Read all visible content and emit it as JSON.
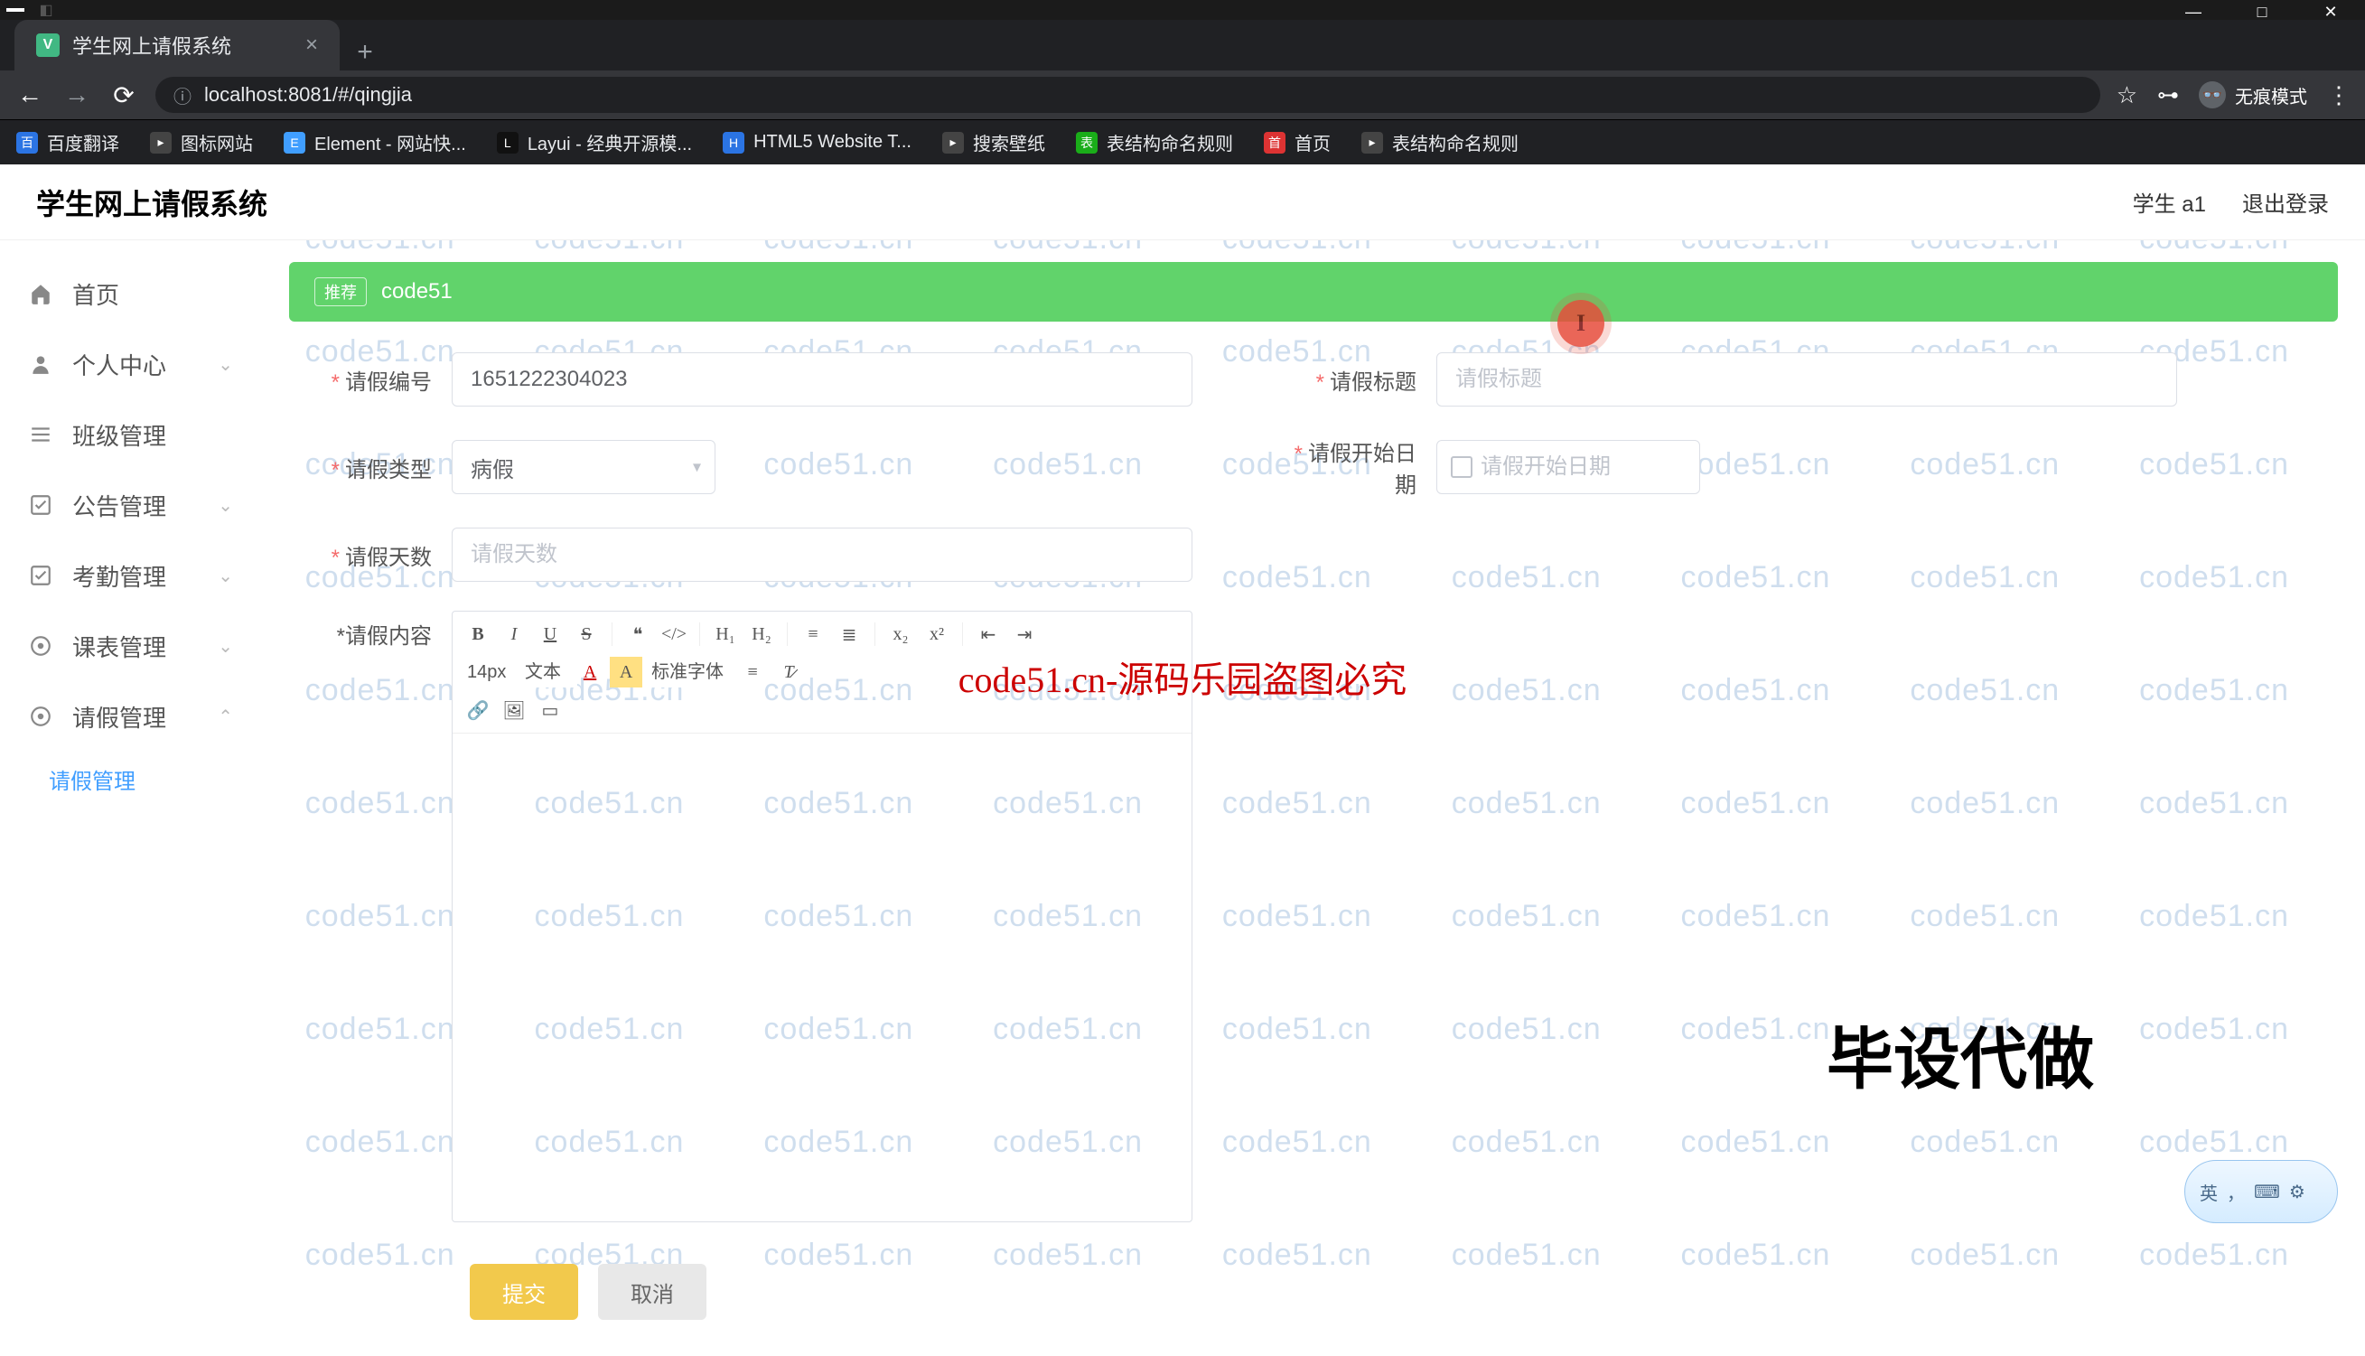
{
  "browser": {
    "tab_title": "学生网上请假系统",
    "url": "localhost:8081/#/qingjia",
    "incognito_label": "无痕模式",
    "bookmarks": [
      {
        "label": "百度翻译",
        "color": "#2b74e3"
      },
      {
        "label": "图标网站",
        "color": "#444"
      },
      {
        "label": "Element - 网站快...",
        "color": "#409eff"
      },
      {
        "label": "Layui - 经典开源模...",
        "color": "#111"
      },
      {
        "label": "HTML5 Website T...",
        "color": "#2b74e3"
      },
      {
        "label": "搜索壁纸",
        "color": "#444"
      },
      {
        "label": "表结构命名规则",
        "color": "#1aad19"
      },
      {
        "label": "首页",
        "color": "#d33"
      },
      {
        "label": "表结构命名规则",
        "color": "#444"
      }
    ]
  },
  "header": {
    "title": "学生网上请假系统",
    "user": "学生 a1",
    "logout": "退出登录"
  },
  "sidebar": {
    "items": [
      {
        "label": "首页",
        "icon": "home"
      },
      {
        "label": "个人中心",
        "icon": "user",
        "children": true
      },
      {
        "label": "班级管理",
        "icon": "list"
      },
      {
        "label": "公告管理",
        "icon": "check",
        "children": true
      },
      {
        "label": "考勤管理",
        "icon": "check",
        "children": true
      },
      {
        "label": "课表管理",
        "icon": "target",
        "children": true
      },
      {
        "label": "请假管理",
        "icon": "target",
        "children": true
      }
    ],
    "active_sub": "请假管理"
  },
  "banner": {
    "tag": "推荐",
    "text": "code51"
  },
  "form": {
    "id_label": "请假编号",
    "id_value": "1651222304023",
    "title_label": "请假标题",
    "title_placeholder": "请假标题",
    "type_label": "请假类型",
    "type_value": "病假",
    "start_label": "请假开始日期",
    "start_placeholder": "请假开始日期",
    "days_label": "请假天数",
    "days_placeholder": "请假天数",
    "content_label": "请假内容"
  },
  "editor_toolbar": {
    "font_size": "14px",
    "block": "文本",
    "font_family": "标准字体"
  },
  "actions": {
    "submit": "提交",
    "cancel": "取消"
  },
  "watermark": {
    "text": "code51.cn",
    "banner": "code51.cn-源码乐园盗图必究",
    "corner": "毕设代做"
  },
  "ime": {
    "lang": "英"
  }
}
